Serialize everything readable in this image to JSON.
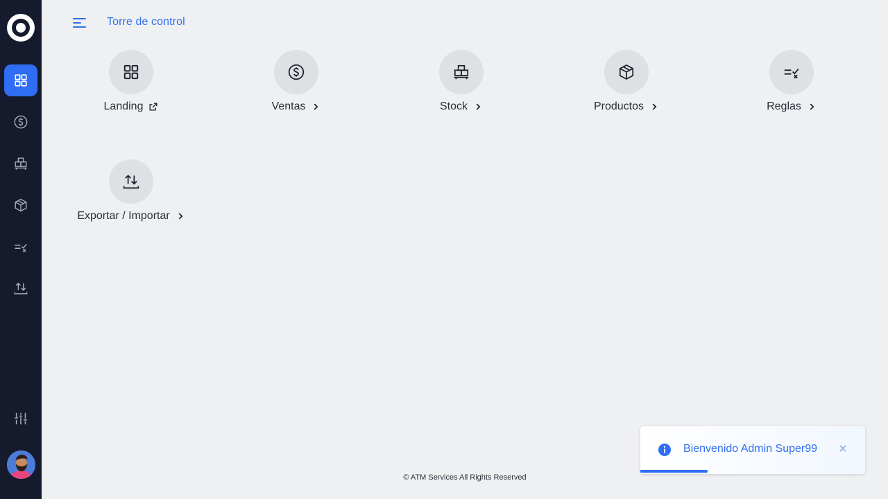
{
  "header": {
    "title": "Torre de control"
  },
  "sidebar": {
    "items": [
      {
        "icon": "dashboard-grid-icon",
        "active": true
      },
      {
        "icon": "dollar-circle-icon",
        "active": false
      },
      {
        "icon": "stock-boxes-icon",
        "active": false
      },
      {
        "icon": "product-box-icon",
        "active": false
      },
      {
        "icon": "rules-check-icon",
        "active": false
      },
      {
        "icon": "export-import-icon",
        "active": false
      }
    ],
    "settings_icon": "sliders-icon"
  },
  "tiles": [
    {
      "label": "Landing",
      "icon": "dashboard-grid-icon",
      "trailing": "external-link-icon"
    },
    {
      "label": "Ventas",
      "icon": "dollar-circle-icon",
      "trailing": "chevron-right-icon"
    },
    {
      "label": "Stock",
      "icon": "stock-boxes-icon",
      "trailing": "chevron-right-icon"
    },
    {
      "label": "Productos",
      "icon": "product-box-icon",
      "trailing": "chevron-right-icon"
    },
    {
      "label": "Reglas",
      "icon": "rules-check-icon",
      "trailing": "chevron-right-icon"
    },
    {
      "label": "Exportar / Importar",
      "icon": "export-import-icon",
      "trailing": "chevron-right-icon"
    }
  ],
  "footer": {
    "text": "© ATM Services All Rights Reserved"
  },
  "toast": {
    "message": "Bienvenido Admin Super99",
    "progress": 0.3
  },
  "colors": {
    "accent": "#2f6ef3",
    "sidebar_bg": "#151b2c",
    "page_bg": "#eff0f2",
    "tile_circle": "#dfe0e3"
  }
}
